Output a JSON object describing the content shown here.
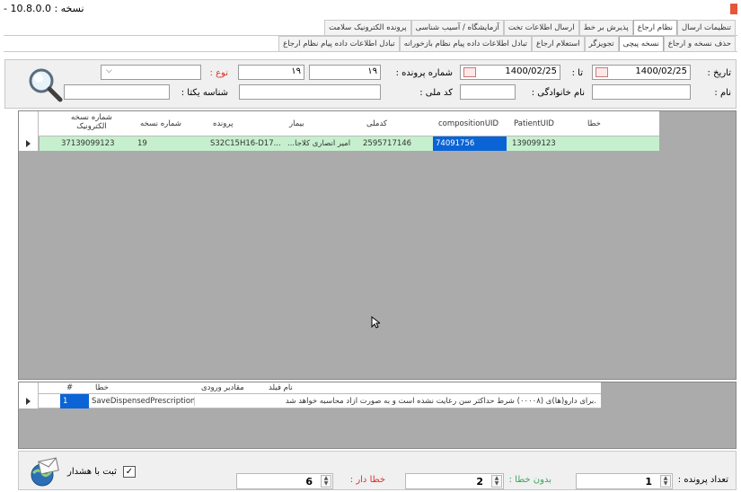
{
  "window": {
    "version": "- 10.8.0.0 : نسخه"
  },
  "tabs_row1": [
    {
      "label": "تنظیمات ارسال",
      "active": false
    },
    {
      "label": "نظام ارجاع",
      "active": true
    },
    {
      "label": "پذیرش بر خط",
      "active": false
    },
    {
      "label": "ارسال اطلاعات تخت",
      "active": false
    },
    {
      "label": "آزمایشگاه / آسیب شناسی",
      "active": false
    },
    {
      "label": "پرونده الکترونیک سلامت",
      "active": false
    }
  ],
  "tabs_row2": [
    {
      "label": "حذف نسخه و ارجاع",
      "active": false
    },
    {
      "label": "نسخه پیچی",
      "active": true
    },
    {
      "label": "تجویزگر",
      "active": false
    },
    {
      "label": "استعلام ارجاع",
      "active": false
    },
    {
      "label": "تبادل اطلاعات داده پیام نظام بازخورانه",
      "active": false
    },
    {
      "label": "تبادل اطلاعات داده پیام نظام ارجاع",
      "active": false
    }
  ],
  "filters": {
    "date_label": "تاریخ :",
    "date_from": "1400/02/25",
    "to_label": "تا :",
    "date_to": "1400/02/25",
    "file_no_label": "شماره پرونده :",
    "file_no_from": "۱۹",
    "file_no_to": "۱۹",
    "type_label": "نوع :",
    "type_value": "",
    "name_label": "نام :",
    "name_value": "",
    "family_label": "نام خانوادگی :",
    "family_value": "",
    "national_code_label": "کد ملی :",
    "national_code_value": "",
    "unique_id_label": "شناسه یکتا :",
    "unique_id_value": ""
  },
  "main_table": {
    "columns": [
      "شماره نسخه الکترونیک",
      "شماره نسخه",
      "پرونده",
      "بیمار",
      "کدملی",
      "compositionUID",
      "PatientUID",
      "خطا"
    ],
    "rows": [
      [
        "37139099123",
        "19",
        "S32C15H16-D17...",
        "...امیر انصاری کلاجا",
        "2595717146",
        "74091756",
        "139099123",
        ""
      ]
    ]
  },
  "error_table": {
    "columns": [
      "#",
      "خطا",
      "مقادیر ورودی",
      "نام فیلد"
    ],
    "rows": [
      [
        "1",
        "SaveDispensedPrescription",
        "",
        ".برای دارو(ها)ی (۰۰۰۰۸) شرط حداکثر سن رعایت نشده است و به صورت آزاد محاسبه خواهد شد"
      ]
    ]
  },
  "footer": {
    "record_count_label": "تعداد پرونده :",
    "record_count": "1",
    "no_error_label": "بدون خطا :",
    "no_error_count": "2",
    "with_error_label": "خطا دار :",
    "with_error_count": "6",
    "warn_checkbox_label": "ثبت با هشدار",
    "warn_checked": true
  },
  "colors": {
    "selected_row": "#c6efce",
    "selected_cell": "#0a64d6",
    "error_label": "#d9302c",
    "no_error_label": "#3aa657"
  }
}
